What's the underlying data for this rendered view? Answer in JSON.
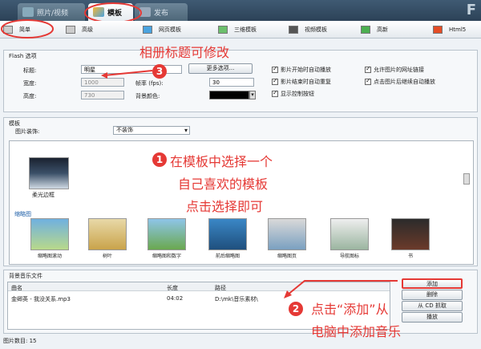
{
  "tabs": {
    "photos": "照片/视频",
    "template": "模板",
    "publish": "发布"
  },
  "logo": "F",
  "subtabs": [
    "简单",
    "高级",
    "网页模板",
    "三维模板",
    "视频模板",
    "高新",
    "Html5"
  ],
  "flash": {
    "section_title": "Flash 选项",
    "title_label": "标题:",
    "title_value": "明星",
    "width_label": "宽度:",
    "width_value": "1000",
    "height_label": "高度:",
    "height_value": "730",
    "fps_label": "帧率 (fps):",
    "fps_value": "30",
    "bgcolor_label": "背景颜色:",
    "more_button": "更多选项...",
    "checks": [
      "影片开始时自动播放",
      "影片结束时自动重复",
      "显示控制按钮",
      "允许图片的网址链接",
      "点击图片后继续自动播放"
    ]
  },
  "template": {
    "section_title": "模板",
    "decoration_label": "图片装饰:",
    "decoration_value": "不装饰",
    "selected_name": "柔光边框",
    "thumbs_heading": "缩略图",
    "thumbs": [
      "缩略图滚动",
      "树叶",
      "缩略图和数字",
      "前后缩略图",
      "缩略图页",
      "导航图标",
      "书"
    ]
  },
  "music": {
    "section_title": "背景音乐文件",
    "col_name": "曲名",
    "col_length": "长度",
    "col_path": "路径",
    "rows": [
      {
        "name": "金卿英 - 我没关系.mp3",
        "length": "04:02",
        "path": "D:\\mk\\音乐素材\\"
      }
    ],
    "buttons": [
      "添加",
      "删除",
      "从 CD 抓取",
      "播放"
    ]
  },
  "status": "图片数目: 15",
  "annotations": {
    "n1": "1",
    "n2": "2",
    "n3": "3",
    "a3": "相册标题可修改",
    "a1_line1": "在模板中选择一个",
    "a1_line2": "自己喜欢的模板",
    "a1_line3": "点击选择即可",
    "a2_line1": "点击“添加”从",
    "a2_line2": "电脑中添加音乐"
  },
  "colors": {
    "annotation": "#e53935",
    "topbar": "#2c4257",
    "highlight": "#1e88e5"
  }
}
